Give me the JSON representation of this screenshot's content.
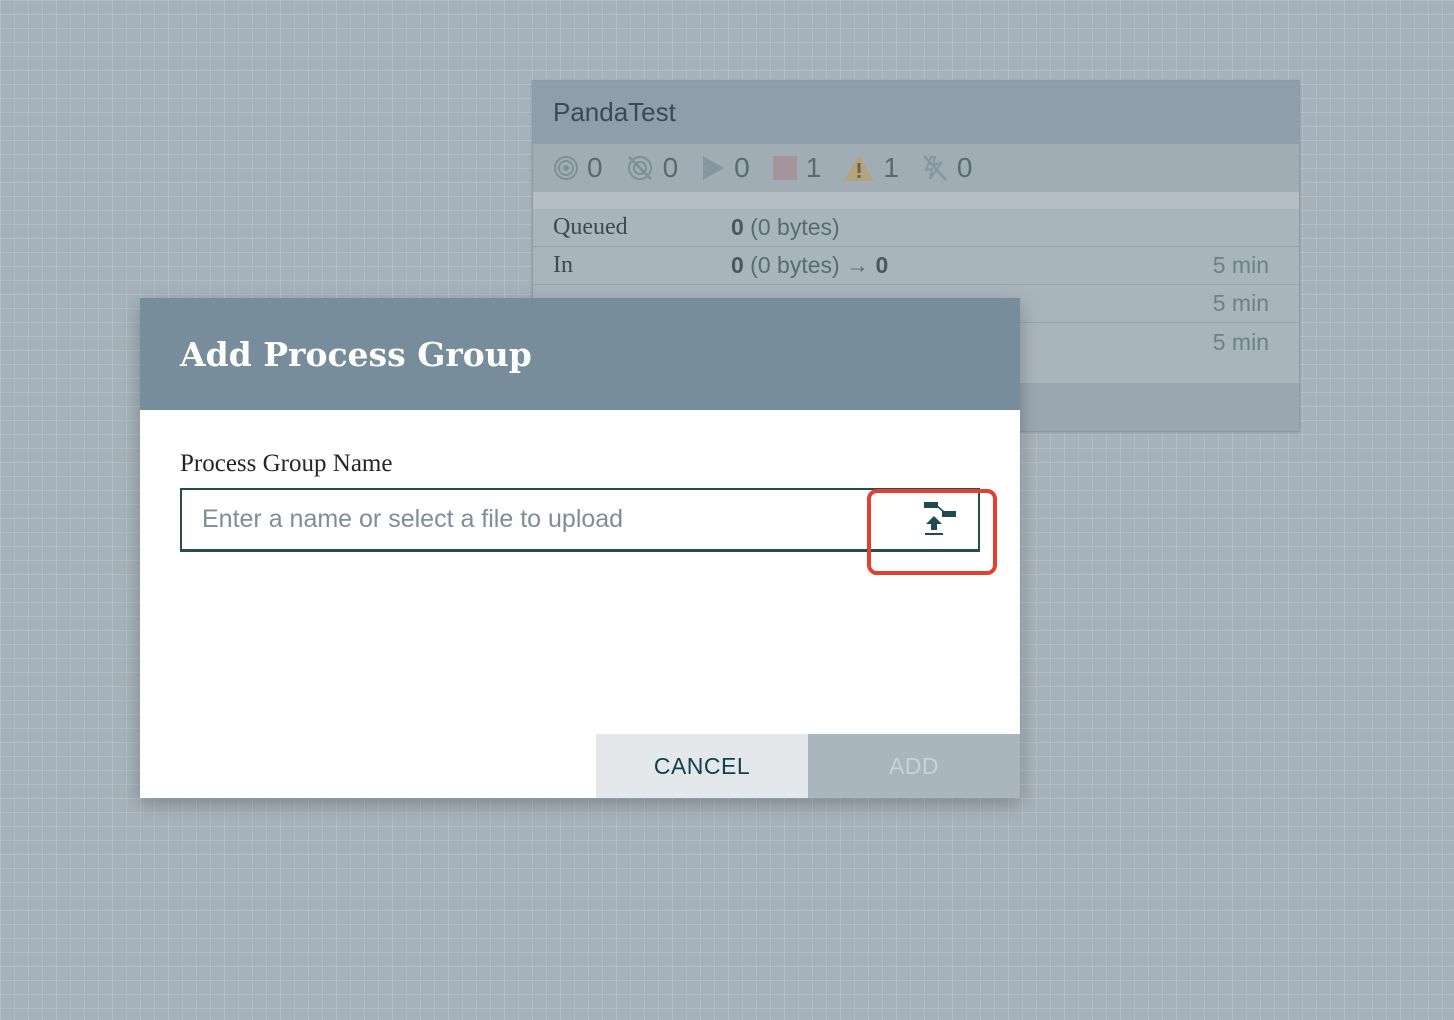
{
  "process_group": {
    "title": "PandaTest",
    "stats": [
      {
        "icon": "transmitting-icon",
        "count": "0"
      },
      {
        "icon": "not-transmitting-icon",
        "count": "0"
      },
      {
        "icon": "running-icon",
        "count": "0"
      },
      {
        "icon": "stopped-icon",
        "count": "1"
      },
      {
        "icon": "invalid-warning-icon",
        "count": "1"
      },
      {
        "icon": "disabled-icon",
        "count": "0"
      }
    ],
    "rows": [
      {
        "label": "Queued",
        "value_bold": "0",
        "value_rest": " (0 bytes)",
        "time": ""
      },
      {
        "label": "In",
        "value_bold": "0",
        "value_rest": " (0 bytes) → ",
        "value_bold2": "0",
        "time": "5 min"
      },
      {
        "label": "",
        "value_bold": "",
        "value_rest": "",
        "time": "5 min"
      },
      {
        "label": "",
        "value_bold": "",
        "value_rest": "",
        "time": "5 min"
      }
    ]
  },
  "dialog": {
    "title": "Add Process Group",
    "field_label": "Process Group Name",
    "input_value": "",
    "input_placeholder": "Enter a name or select a file to upload",
    "cancel_label": "CANCEL",
    "add_label": "ADD"
  },
  "colors": {
    "canvas_bg": "#a6b2bb",
    "dialog_header": "#778d9b",
    "highlight": "#e3402f",
    "input_border": "#264d4d"
  }
}
